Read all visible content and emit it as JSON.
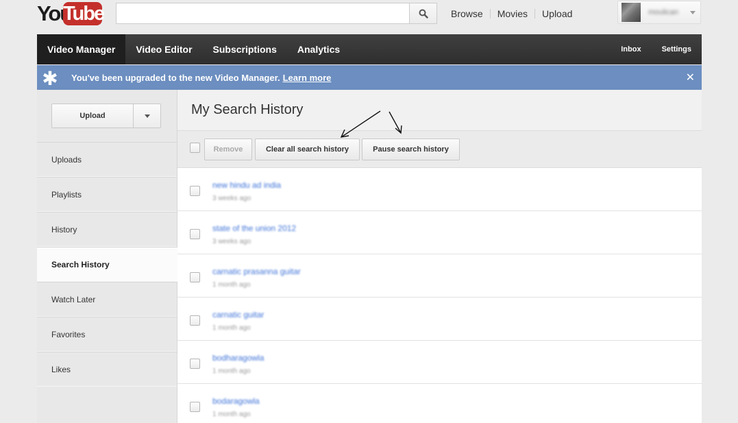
{
  "masthead": {
    "logo_you": "You",
    "logo_tube": "Tube",
    "search_placeholder": "",
    "nav": [
      "Browse",
      "Movies",
      "Upload"
    ],
    "username": "moulican"
  },
  "navbar": {
    "tabs": [
      "Video Manager",
      "Video Editor",
      "Subscriptions",
      "Analytics"
    ],
    "right_tabs": [
      "Inbox",
      "Settings"
    ]
  },
  "notice": {
    "message": "You've been upgraded to the new Video Manager.",
    "link": "Learn more",
    "close": "✕"
  },
  "sidebar": {
    "upload_label": "Upload",
    "items": [
      "Uploads",
      "Playlists",
      "History",
      "Search History",
      "Watch Later",
      "Favorites",
      "Likes"
    ],
    "active": "Search History"
  },
  "main": {
    "title": "My Search History",
    "toolbar": {
      "remove": "Remove",
      "clear_all": "Clear all search history",
      "pause": "Pause search history"
    },
    "rows": [
      {
        "query": "new hindu ad india",
        "time": "3 weeks ago"
      },
      {
        "query": "state of the union 2012",
        "time": "3 weeks ago"
      },
      {
        "query": "carnatic prasanna guitar",
        "time": "1 month ago"
      },
      {
        "query": "carnatic guitar",
        "time": "1 month ago"
      },
      {
        "query": "bodharagowla",
        "time": "1 month ago"
      },
      {
        "query": "bodaragowla",
        "time": "1 month ago"
      }
    ]
  },
  "colors": {
    "notice_bg": "#6c8ec0",
    "navbar_bg": "#333333",
    "logo_red": "#c4302b",
    "link_blue": "#3f73d8"
  }
}
